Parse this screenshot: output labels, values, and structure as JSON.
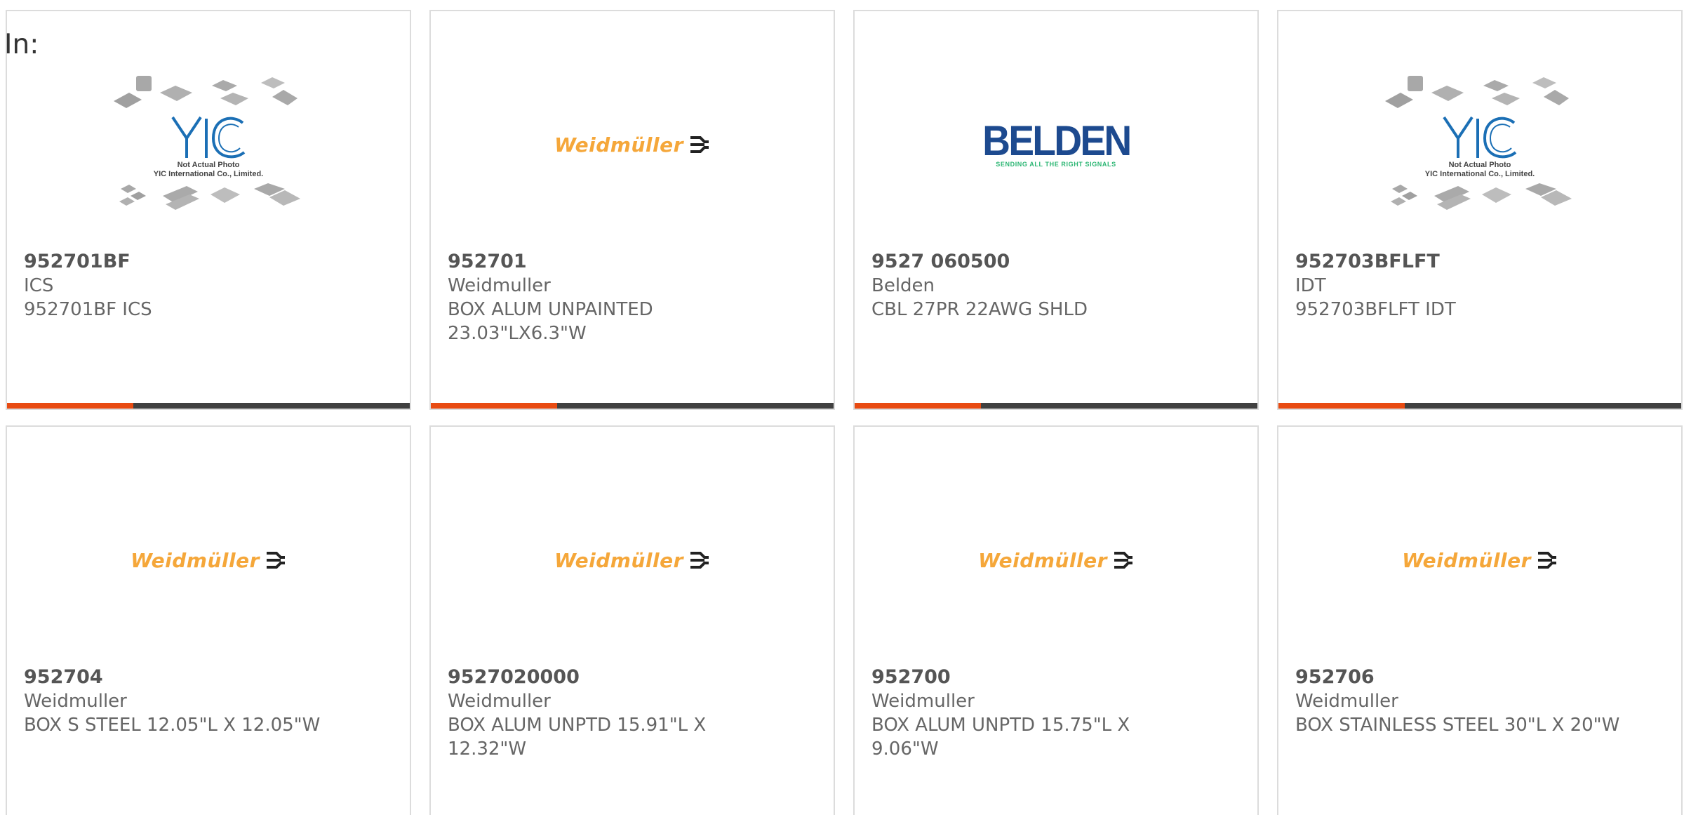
{
  "header": {
    "in_label": "In:"
  },
  "placeholder": {
    "line1": "Not Actual Photo",
    "line2": "YIC International Co., Limited.",
    "logo_text": "YIC"
  },
  "brand_logos": {
    "weidmuller": "Weidmüller",
    "belden": "BELDEN",
    "belden_tagline": "SENDING ALL THE RIGHT SIGNALS"
  },
  "colors": {
    "accent": "#e84b12",
    "bar_dark": "#404040",
    "weidmuller_orange": "#f5a73a",
    "belden_blue": "#1d4a8f",
    "belden_green": "#2bb673",
    "yic_blue": "#1b6fb5"
  },
  "products": [
    {
      "part": "952701BF",
      "maker": "ICS",
      "desc": "952701BF ICS",
      "image": "yic-placeholder"
    },
    {
      "part": "952701",
      "maker": "Weidmuller",
      "desc": "BOX ALUM UNPAINTED 23.03\"LX6.3\"W",
      "image": "weidmuller-logo"
    },
    {
      "part": "9527 060500",
      "maker": "Belden",
      "desc": "CBL 27PR 22AWG SHLD",
      "image": "belden-logo"
    },
    {
      "part": "952703BFLFT",
      "maker": "IDT",
      "desc": "952703BFLFT IDT",
      "image": "yic-placeholder"
    },
    {
      "part": "952704",
      "maker": "Weidmuller",
      "desc": "BOX S STEEL 12.05\"L X 12.05\"W",
      "image": "weidmuller-logo"
    },
    {
      "part": "9527020000",
      "maker": "Weidmuller",
      "desc": "BOX ALUM UNPTD 15.91\"L X 12.32\"W",
      "image": "weidmuller-logo"
    },
    {
      "part": "952700",
      "maker": "Weidmuller",
      "desc": "BOX ALUM UNPTD 15.75\"L X 9.06\"W",
      "image": "weidmuller-logo"
    },
    {
      "part": "952706",
      "maker": "Weidmuller",
      "desc": "BOX STAINLESS STEEL 30\"L X 20\"W",
      "image": "weidmuller-logo"
    }
  ]
}
